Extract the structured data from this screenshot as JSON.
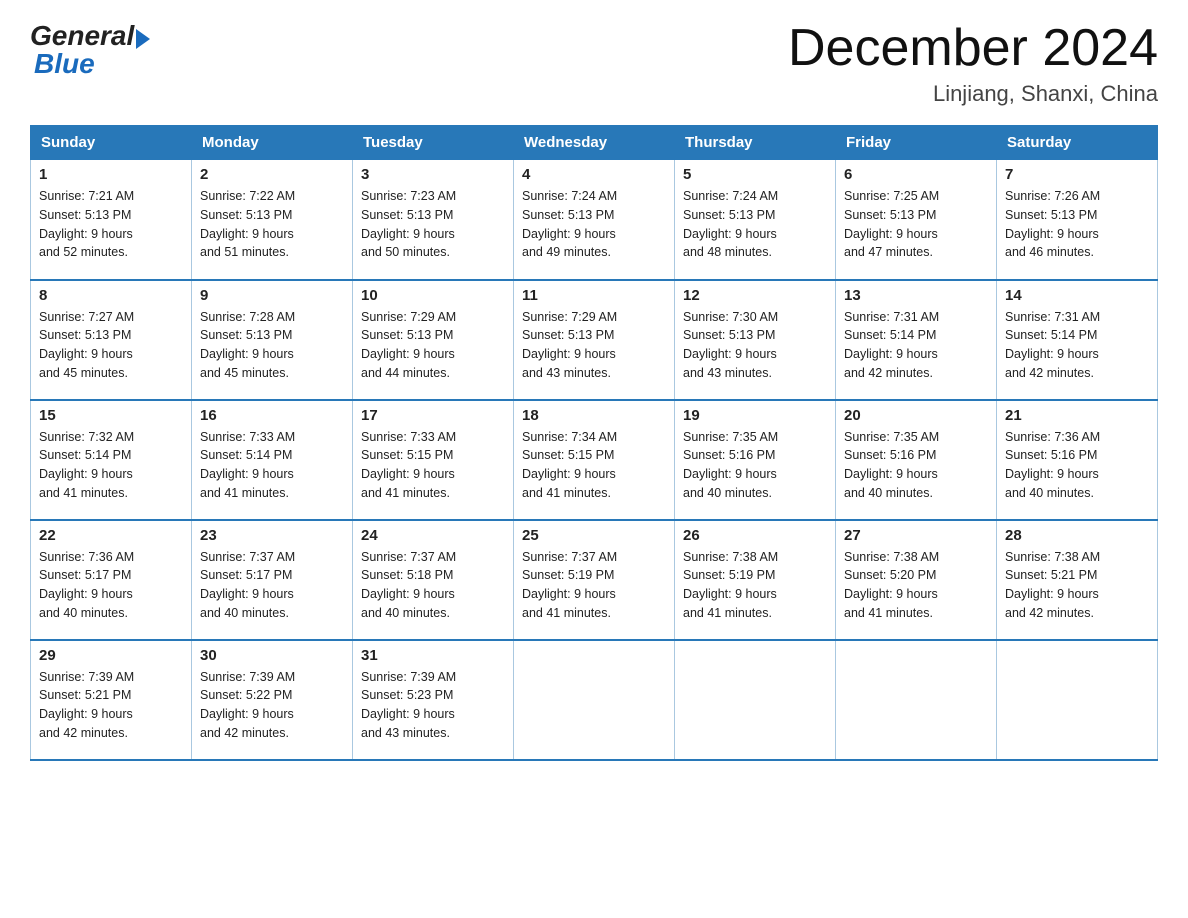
{
  "logo": {
    "general": "General",
    "blue": "Blue"
  },
  "title": "December 2024",
  "subtitle": "Linjiang, Shanxi, China",
  "headers": [
    "Sunday",
    "Monday",
    "Tuesday",
    "Wednesday",
    "Thursday",
    "Friday",
    "Saturday"
  ],
  "weeks": [
    [
      {
        "num": "1",
        "sunrise": "7:21 AM",
        "sunset": "5:13 PM",
        "daylight": "9 hours and 52 minutes."
      },
      {
        "num": "2",
        "sunrise": "7:22 AM",
        "sunset": "5:13 PM",
        "daylight": "9 hours and 51 minutes."
      },
      {
        "num": "3",
        "sunrise": "7:23 AM",
        "sunset": "5:13 PM",
        "daylight": "9 hours and 50 minutes."
      },
      {
        "num": "4",
        "sunrise": "7:24 AM",
        "sunset": "5:13 PM",
        "daylight": "9 hours and 49 minutes."
      },
      {
        "num": "5",
        "sunrise": "7:24 AM",
        "sunset": "5:13 PM",
        "daylight": "9 hours and 48 minutes."
      },
      {
        "num": "6",
        "sunrise": "7:25 AM",
        "sunset": "5:13 PM",
        "daylight": "9 hours and 47 minutes."
      },
      {
        "num": "7",
        "sunrise": "7:26 AM",
        "sunset": "5:13 PM",
        "daylight": "9 hours and 46 minutes."
      }
    ],
    [
      {
        "num": "8",
        "sunrise": "7:27 AM",
        "sunset": "5:13 PM",
        "daylight": "9 hours and 45 minutes."
      },
      {
        "num": "9",
        "sunrise": "7:28 AM",
        "sunset": "5:13 PM",
        "daylight": "9 hours and 45 minutes."
      },
      {
        "num": "10",
        "sunrise": "7:29 AM",
        "sunset": "5:13 PM",
        "daylight": "9 hours and 44 minutes."
      },
      {
        "num": "11",
        "sunrise": "7:29 AM",
        "sunset": "5:13 PM",
        "daylight": "9 hours and 43 minutes."
      },
      {
        "num": "12",
        "sunrise": "7:30 AM",
        "sunset": "5:13 PM",
        "daylight": "9 hours and 43 minutes."
      },
      {
        "num": "13",
        "sunrise": "7:31 AM",
        "sunset": "5:14 PM",
        "daylight": "9 hours and 42 minutes."
      },
      {
        "num": "14",
        "sunrise": "7:31 AM",
        "sunset": "5:14 PM",
        "daylight": "9 hours and 42 minutes."
      }
    ],
    [
      {
        "num": "15",
        "sunrise": "7:32 AM",
        "sunset": "5:14 PM",
        "daylight": "9 hours and 41 minutes."
      },
      {
        "num": "16",
        "sunrise": "7:33 AM",
        "sunset": "5:14 PM",
        "daylight": "9 hours and 41 minutes."
      },
      {
        "num": "17",
        "sunrise": "7:33 AM",
        "sunset": "5:15 PM",
        "daylight": "9 hours and 41 minutes."
      },
      {
        "num": "18",
        "sunrise": "7:34 AM",
        "sunset": "5:15 PM",
        "daylight": "9 hours and 41 minutes."
      },
      {
        "num": "19",
        "sunrise": "7:35 AM",
        "sunset": "5:16 PM",
        "daylight": "9 hours and 40 minutes."
      },
      {
        "num": "20",
        "sunrise": "7:35 AM",
        "sunset": "5:16 PM",
        "daylight": "9 hours and 40 minutes."
      },
      {
        "num": "21",
        "sunrise": "7:36 AM",
        "sunset": "5:16 PM",
        "daylight": "9 hours and 40 minutes."
      }
    ],
    [
      {
        "num": "22",
        "sunrise": "7:36 AM",
        "sunset": "5:17 PM",
        "daylight": "9 hours and 40 minutes."
      },
      {
        "num": "23",
        "sunrise": "7:37 AM",
        "sunset": "5:17 PM",
        "daylight": "9 hours and 40 minutes."
      },
      {
        "num": "24",
        "sunrise": "7:37 AM",
        "sunset": "5:18 PM",
        "daylight": "9 hours and 40 minutes."
      },
      {
        "num": "25",
        "sunrise": "7:37 AM",
        "sunset": "5:19 PM",
        "daylight": "9 hours and 41 minutes."
      },
      {
        "num": "26",
        "sunrise": "7:38 AM",
        "sunset": "5:19 PM",
        "daylight": "9 hours and 41 minutes."
      },
      {
        "num": "27",
        "sunrise": "7:38 AM",
        "sunset": "5:20 PM",
        "daylight": "9 hours and 41 minutes."
      },
      {
        "num": "28",
        "sunrise": "7:38 AM",
        "sunset": "5:21 PM",
        "daylight": "9 hours and 42 minutes."
      }
    ],
    [
      {
        "num": "29",
        "sunrise": "7:39 AM",
        "sunset": "5:21 PM",
        "daylight": "9 hours and 42 minutes."
      },
      {
        "num": "30",
        "sunrise": "7:39 AM",
        "sunset": "5:22 PM",
        "daylight": "9 hours and 42 minutes."
      },
      {
        "num": "31",
        "sunrise": "7:39 AM",
        "sunset": "5:23 PM",
        "daylight": "9 hours and 43 minutes."
      },
      null,
      null,
      null,
      null
    ]
  ],
  "labels": {
    "sunrise": "Sunrise:",
    "sunset": "Sunset:",
    "daylight": "Daylight:"
  }
}
